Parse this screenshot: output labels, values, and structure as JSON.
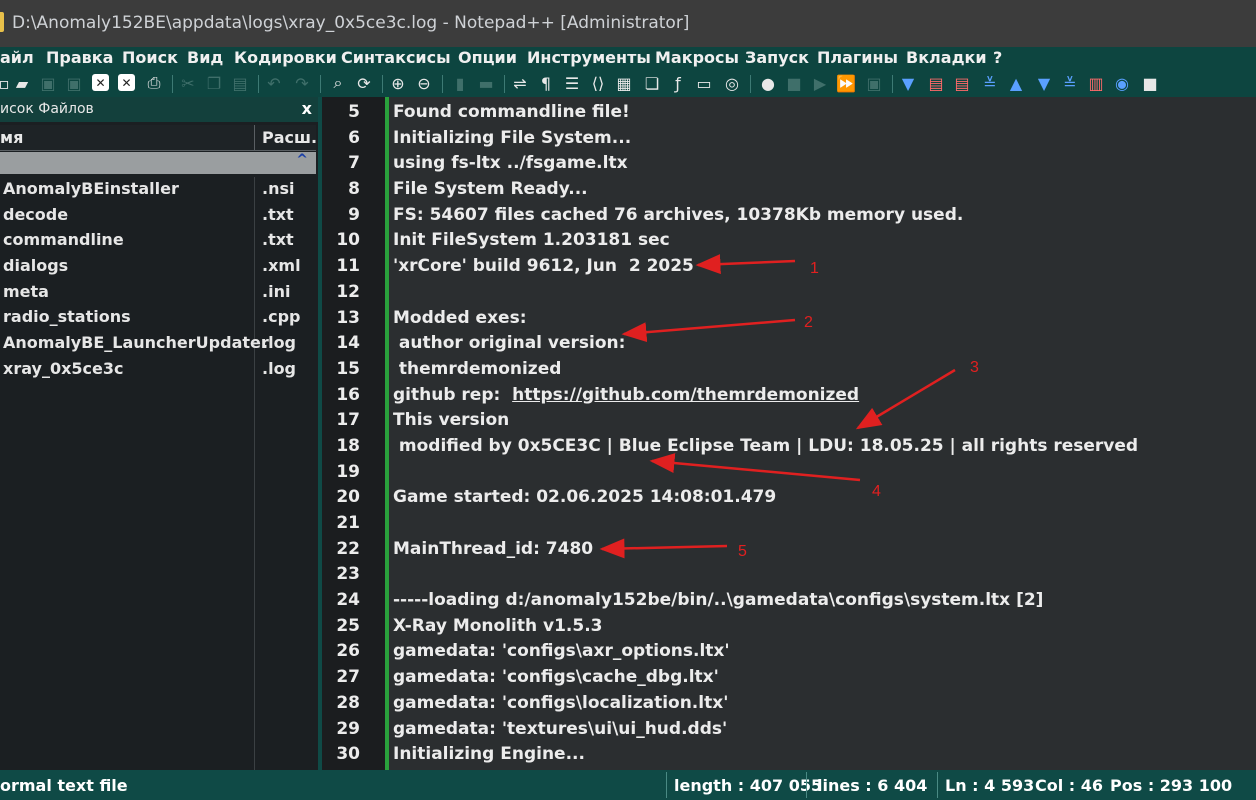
{
  "window": {
    "title": "D:\\Anomaly152BE\\appdata\\logs\\xray_0x5ce3c.log - Notepad++ [Administrator]"
  },
  "menu": [
    "айл",
    "Правка",
    "Поиск",
    "Вид",
    "Кодировки",
    "Синтаксисы",
    "Опции",
    "Инструменты",
    "Макросы",
    "Запуск",
    "Плагины",
    "Вкладки",
    "?"
  ],
  "file_panel": {
    "title": "исок Файлов",
    "close": "x",
    "col_name": "мя",
    "col_ext": "Расш.",
    "sort_indicator": "^",
    "files": [
      {
        "name": "AnomalyBEinstaller",
        "ext": ".nsi"
      },
      {
        "name": "decode",
        "ext": ".txt"
      },
      {
        "name": "commandline",
        "ext": ".txt"
      },
      {
        "name": "dialogs",
        "ext": ".xml"
      },
      {
        "name": "meta",
        "ext": ".ini"
      },
      {
        "name": "radio_stations",
        "ext": ".cpp"
      },
      {
        "name": "AnomalyBE_LauncherUpdater",
        "ext": ".log"
      },
      {
        "name": "xray_0x5ce3c",
        "ext": ".log"
      }
    ]
  },
  "editor": {
    "lines": [
      {
        "n": "5",
        "t": "Found commandline file!"
      },
      {
        "n": "6",
        "t": "Initializing File System..."
      },
      {
        "n": "7",
        "t": "using fs-ltx ../fsgame.ltx"
      },
      {
        "n": "8",
        "t": "File System Ready..."
      },
      {
        "n": "9",
        "t": "FS: 54607 files cached 76 archives, 10378Kb memory used."
      },
      {
        "n": "10",
        "t": "Init FileSystem 1.203181 sec"
      },
      {
        "n": "11",
        "t": "'xrCore' build 9612, Jun  2 2025"
      },
      {
        "n": "12",
        "t": ""
      },
      {
        "n": "13",
        "t": "Modded exes:"
      },
      {
        "n": "14",
        "t": " author original version:"
      },
      {
        "n": "15",
        "t": " themrdemonized"
      },
      {
        "n": "16",
        "t": "github rep:  ",
        "link": "https://github.com/themrdemonized"
      },
      {
        "n": "17",
        "t": "This version"
      },
      {
        "n": "18",
        "t": " modified by 0x5CE3C | Blue Eclipse Team | LDU: 18.05.25 | all rights reserved"
      },
      {
        "n": "19",
        "t": ""
      },
      {
        "n": "20",
        "t": "Game started: 02.06.2025 14:08:01.479"
      },
      {
        "n": "21",
        "t": ""
      },
      {
        "n": "22",
        "t": "MainThread_id: 7480"
      },
      {
        "n": "23",
        "t": ""
      },
      {
        "n": "24",
        "t": "-----loading d:/anomaly152be/bin/..\\gamedata\\configs\\system.ltx [2]"
      },
      {
        "n": "25",
        "t": "X-Ray Monolith v1.5.3"
      },
      {
        "n": "26",
        "t": "gamedata: 'configs\\axr_options.ltx'"
      },
      {
        "n": "27",
        "t": "gamedata: 'configs\\cache_dbg.ltx'"
      },
      {
        "n": "28",
        "t": "gamedata: 'configs\\localization.ltx'"
      },
      {
        "n": "29",
        "t": "gamedata: 'textures\\ui\\ui_hud.dds'"
      },
      {
        "n": "30",
        "t": "Initializing Engine..."
      }
    ]
  },
  "status": {
    "filetype": "ormal text file",
    "length": "length : 407 055",
    "lines": "lines : 6 404",
    "ln": "Ln : 4 593",
    "col": "Col : 46",
    "pos": "Pos : 293 100"
  },
  "annotations": [
    "1",
    "2",
    "3",
    "4",
    "5"
  ],
  "colors": {
    "accent_arrow": "#e02020",
    "change_bar": "#2aa13c",
    "chrome": "#0f4a46"
  }
}
